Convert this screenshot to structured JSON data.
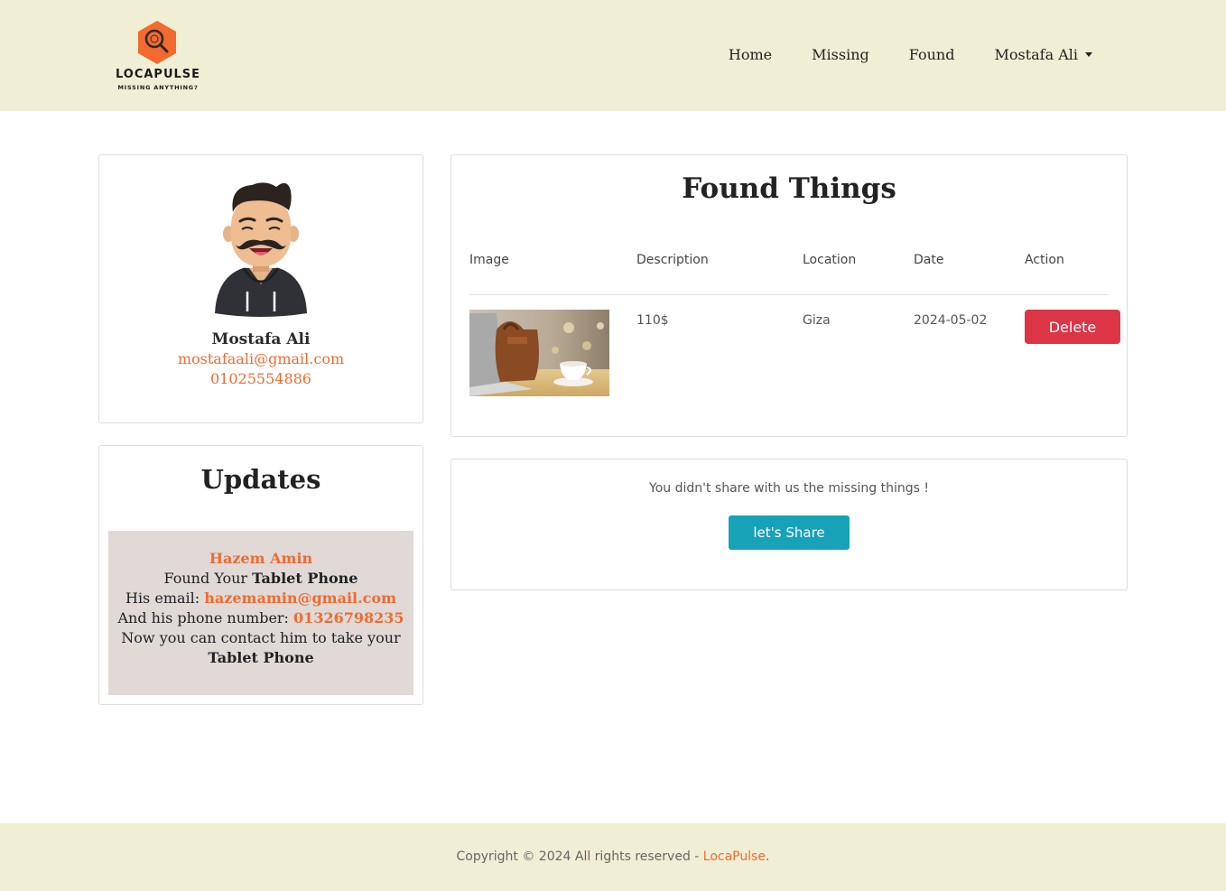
{
  "brand": {
    "name": "LOCAPULSE",
    "tagline": "MISSING ANYTHING?",
    "color": "#f26a2e"
  },
  "nav": {
    "items": [
      {
        "label": "Home"
      },
      {
        "label": "Missing"
      },
      {
        "label": "Found"
      }
    ],
    "user_menu": "Mostafa Ali"
  },
  "profile": {
    "name": "Mostafa Ali",
    "email": "mostafaali@gmail.com",
    "phone": "01025554886"
  },
  "updates": {
    "title": "Updates",
    "item": {
      "sender": "Hazem Amin",
      "found_prefix": "Found Your",
      "item_name": "Tablet Phone",
      "email_label": "His email:",
      "email": "hazemamin@gmail.com",
      "phone_label": "And his phone number:",
      "phone": "01326798235",
      "contact_text": "Now you can contact him to take your",
      "item_name_end": "Tablet Phone"
    }
  },
  "found": {
    "title": "Found Things",
    "columns": [
      "Image",
      "Description",
      "Location",
      "Date",
      "Action"
    ],
    "rows": [
      {
        "description": "110$",
        "location": "Giza",
        "date": "2024-05-02",
        "action_label": "Delete"
      }
    ]
  },
  "share": {
    "message": "You didn't share with us the missing things !",
    "button_label": "let's Share"
  },
  "footer": {
    "text": "Copyright © 2024 All rights reserved - ",
    "link": "LocaPulse",
    "suffix": "."
  },
  "colors": {
    "header_bg": "#f1eed6",
    "accent": "#f26a2e",
    "danger": "#dc3545",
    "info": "#17a2b8",
    "update_bg": "#e0d9d6"
  }
}
